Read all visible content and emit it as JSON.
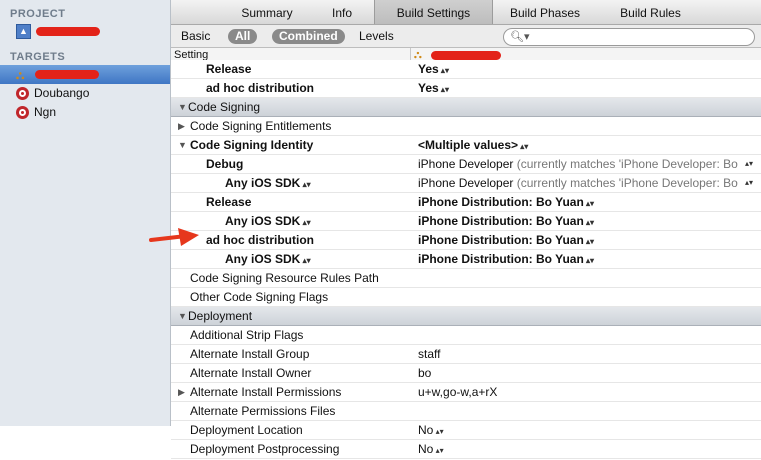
{
  "sidebar": {
    "project_header": "PROJECT",
    "targets_header": "TARGETS",
    "targets": [
      {
        "label": "Doubango"
      },
      {
        "label": "Ngn"
      }
    ]
  },
  "tabs": [
    "Summary",
    "Info",
    "Build Settings",
    "Build Phases",
    "Build Rules"
  ],
  "active_tab": "Build Settings",
  "filter": {
    "basic": "Basic",
    "all": "All",
    "combined": "Combined",
    "levels": "Levels",
    "search_icon": "magnifier-icon"
  },
  "columns": {
    "setting": "Setting"
  },
  "rows": [
    {
      "name": "Release",
      "value": "Yes",
      "bold": true,
      "indent": 2,
      "stepper": true
    },
    {
      "name": "ad hoc distribution",
      "value": "Yes",
      "bold": true,
      "indent": 2,
      "stepper": true
    },
    {
      "group": true,
      "name": "Code Signing"
    },
    {
      "name": "Code Signing Entitlements",
      "value": "",
      "indent": 1,
      "disclosure": "right"
    },
    {
      "name": "Code Signing Identity",
      "value": "<Multiple values>",
      "bold": true,
      "indent": 1,
      "disclosure": "down",
      "stepper": true
    },
    {
      "name": "Debug",
      "value": "iPhone Developer",
      "hint": "(currently matches 'iPhone Developer: Bo",
      "bold": true,
      "indent": 2,
      "stepper": true
    },
    {
      "name": "Any iOS SDK",
      "value": "iPhone Developer",
      "hint": "(currently matches 'iPhone Developer: Bo",
      "bold": true,
      "indent": 3,
      "stepper": true,
      "namestepper": true
    },
    {
      "name": "Release",
      "value": "iPhone Distribution: Bo Yuan",
      "bold": true,
      "indent": 2,
      "stepper": true
    },
    {
      "name": "Any iOS SDK",
      "value": "iPhone Distribution: Bo Yuan",
      "bold": true,
      "indent": 3,
      "stepper": true,
      "namestepper": true
    },
    {
      "name": "ad hoc distribution",
      "value": "iPhone Distribution: Bo Yuan",
      "bold": true,
      "indent": 2,
      "stepper": true
    },
    {
      "name": "Any iOS SDK",
      "value": "iPhone Distribution: Bo Yuan",
      "bold": true,
      "indent": 3,
      "stepper": true,
      "namestepper": true
    },
    {
      "name": "Code Signing Resource Rules Path",
      "value": "",
      "indent": 1
    },
    {
      "name": "Other Code Signing Flags",
      "value": "",
      "indent": 1
    },
    {
      "group": true,
      "name": "Deployment"
    },
    {
      "name": "Additional Strip Flags",
      "value": "",
      "indent": 1
    },
    {
      "name": "Alternate Install Group",
      "value": "staff",
      "indent": 1
    },
    {
      "name": "Alternate Install Owner",
      "value": "bo",
      "indent": 1
    },
    {
      "name": "Alternate Install Permissions",
      "value": "u+w,go-w,a+rX",
      "indent": 1,
      "disclosure": "right"
    },
    {
      "name": "Alternate Permissions Files",
      "value": "",
      "indent": 1
    },
    {
      "name": "Deployment Location",
      "value": "No",
      "indent": 1,
      "stepper": true
    },
    {
      "name": "Deployment Postprocessing",
      "value": "No",
      "indent": 1,
      "stepper": true
    }
  ]
}
